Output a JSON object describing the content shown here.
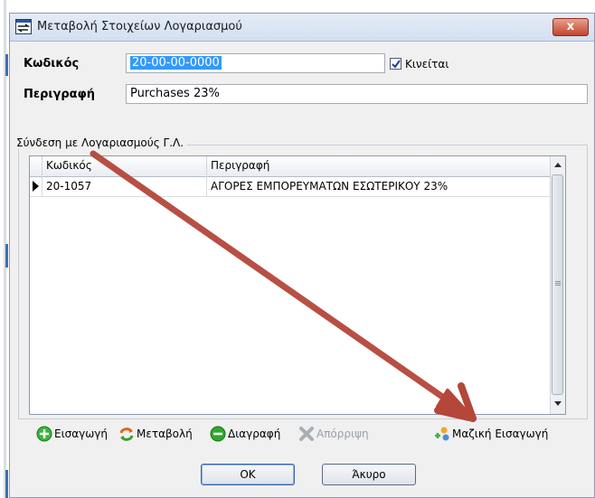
{
  "window": {
    "title": "Μεταβολή Στοιχείων Λογαριασμού",
    "close_glyph": "x"
  },
  "form": {
    "code_label": "Κωδικός",
    "code_value": "20-00-00-0000",
    "moves_checkbox": {
      "label": "Κινείται",
      "checked": true
    },
    "description_label": "Περιγραφή",
    "description_value": "Purchases 23%"
  },
  "link_group": {
    "title": "Σύνδεση με Λογαριασμούς Γ.Λ.",
    "columns": [
      "Κωδικός",
      "Περιγραφή"
    ],
    "rows": [
      {
        "code": "20-1057",
        "description": "ΑΓΟΡΕΣ ΕΜΠΟΡΕΥΜΑΤΩΝ ΕΣΩΤΕΡΙΚΟΥ 23%"
      }
    ]
  },
  "toolbar": {
    "insert": "Εισαγωγή",
    "modify": "Μεταβολή",
    "delete": "Διαγραφή",
    "reject": "Απόρριψη",
    "bulk_insert": "Μαζική Εισαγωγή"
  },
  "buttons": {
    "ok": "OK",
    "cancel": "Άκυρο"
  },
  "colors": {
    "selection": "#3399ff",
    "annotation_arrow": "#b5463a",
    "insert_icon": "#3cb43c",
    "delete_icon": "#2fa82f"
  },
  "icons": [
    "window-icon",
    "close-icon",
    "checkmark-icon",
    "row-pointer-icon",
    "scroll-up-icon",
    "scroll-down-icon",
    "plus-circle-icon",
    "refresh-arrows-icon",
    "minus-circle-icon",
    "x-mark-icon",
    "bulk-insert-icon",
    "annotation-arrow"
  ]
}
